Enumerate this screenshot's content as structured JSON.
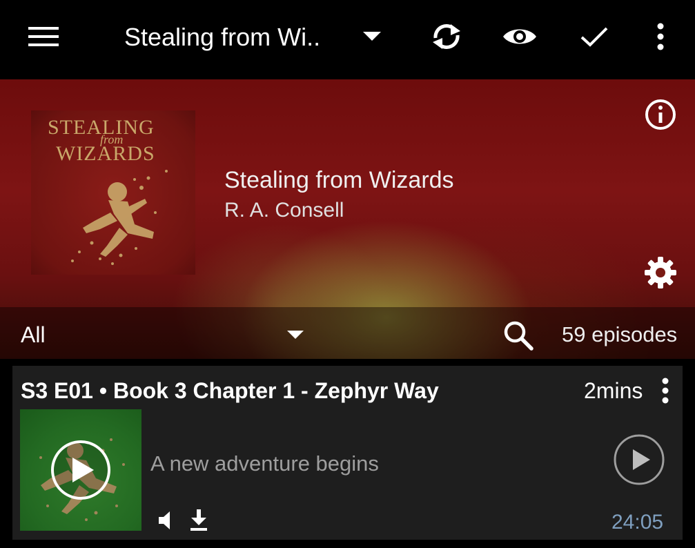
{
  "appbar": {
    "title": "Stealing from Wi..",
    "icons": [
      "menu-icon",
      "caret-down-icon",
      "refresh-icon",
      "eye-icon",
      "check-icon",
      "more-vert-icon"
    ]
  },
  "podcast": {
    "title": "Stealing from Wizards",
    "author": "R. A. Consell",
    "cover_text": {
      "line1": "STEALING",
      "line2": "from",
      "line3": "WIZARDS"
    }
  },
  "filter": {
    "selected": "All",
    "episode_count": "59 episodes"
  },
  "episode": {
    "title": "S3 E01 • Book 3 Chapter 1 - Zephyr Way",
    "duration": "2mins",
    "description": "A new adventure begins",
    "time": "24:05"
  },
  "colors": {
    "hero_red": "#7e1414",
    "card_bg": "#1e1e1e",
    "time_color": "#7f9fbf",
    "desc_color": "#9e9e9e",
    "gold": "#c9a86a",
    "thumb_green": "#2f7a2a"
  }
}
